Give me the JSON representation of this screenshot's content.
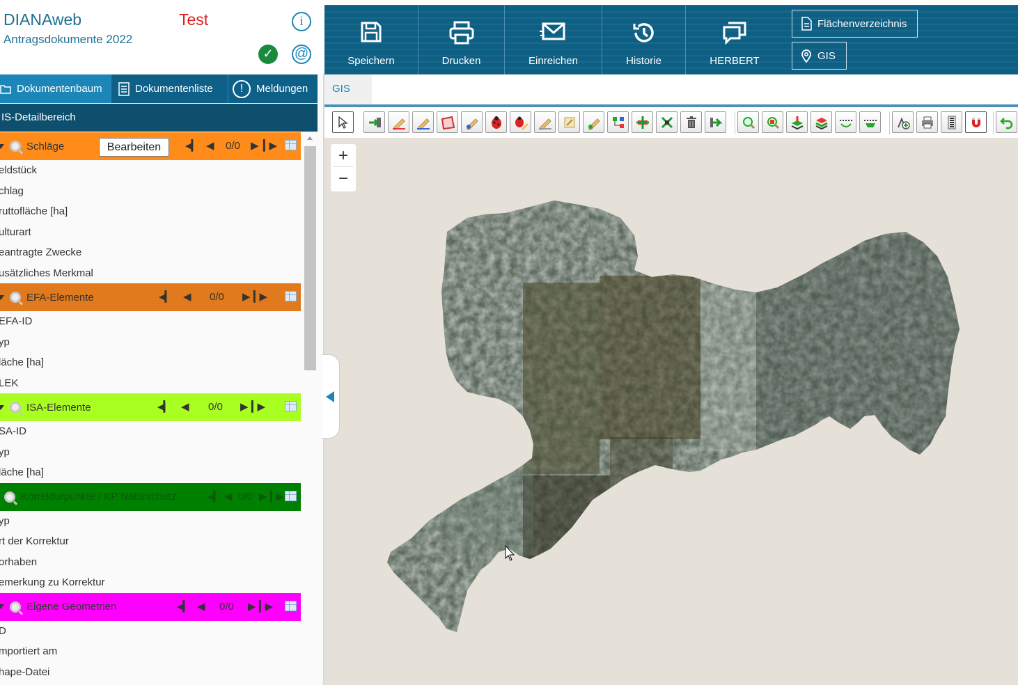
{
  "header": {
    "app_name": "DIANAweb",
    "subtitle": "Antragsdokumente 2022",
    "environment": "Test",
    "info_glyph": "i",
    "check_glyph": "✓",
    "at_glyph": "@"
  },
  "tabs": [
    {
      "label": "Dokumentenbaum",
      "icon": "folder-icon",
      "active": true
    },
    {
      "label": "Dokumentenliste",
      "icon": "list-icon"
    },
    {
      "label": "Meldungen",
      "icon": "alert-icon",
      "glyph": "!"
    }
  ],
  "detail_header": "IS-Detailbereich",
  "sections": [
    {
      "title": "Schläge",
      "color": "#ff8c1a",
      "text_color": "#333333",
      "edit_label": "Bearbeiten",
      "counter": "0/0",
      "fields": [
        "eldstück",
        "chlag",
        "ruttofläche [ha]",
        "ulturart",
        "eantragte Zwecke",
        "usätzliches Merkmal"
      ]
    },
    {
      "title": "EFA-Elemente",
      "color": "#e07a1c",
      "text_color": "#333333",
      "counter": "0/0",
      "fields": [
        "EFA-ID",
        "yp",
        "läche [ha]",
        "LEK"
      ]
    },
    {
      "title": "ISA-Elemente",
      "color": "#aaff22",
      "text_color": "#333333",
      "counter": "0/0",
      "fields": [
        "SA-ID",
        "yp",
        "läche [ha]"
      ]
    },
    {
      "title": "Korrekturpunkte / KP Naturschutz",
      "color": "#008000",
      "text_color": "#0a5a0a",
      "counter": "0/0",
      "fields": [
        "yp",
        "rt der Korrektur",
        "orhaben",
        "emerkung zu Korrektur"
      ]
    },
    {
      "title": "Eigene Geometrien",
      "color": "#ff00ff",
      "text_color": "#333333",
      "counter": "0/0",
      "fields": [
        "D",
        "mportiert am",
        "hape-Datei"
      ]
    }
  ],
  "top_buttons": [
    {
      "label": "Speichern",
      "icon": "floppy-icon"
    },
    {
      "label": "Drucken",
      "icon": "printer-icon"
    },
    {
      "label": "Einreichen",
      "icon": "envelope-icon"
    },
    {
      "label": "Historie",
      "icon": "history-icon"
    },
    {
      "label": "HERBERT",
      "icon": "chat-icon"
    }
  ],
  "outline_buttons": [
    {
      "label": "Flächenverzeichnis",
      "icon": "document-icon"
    },
    {
      "label": "GIS",
      "icon": "location-pin-icon"
    }
  ],
  "gis_tab": "GIS",
  "map": {
    "zoom_in": "+",
    "zoom_out": "−"
  },
  "colors": {
    "topbar": "#0e5f84",
    "tab_active": "#1c86b8",
    "tabbar": "#0e6088",
    "detail_header": "#0e4f6e"
  }
}
